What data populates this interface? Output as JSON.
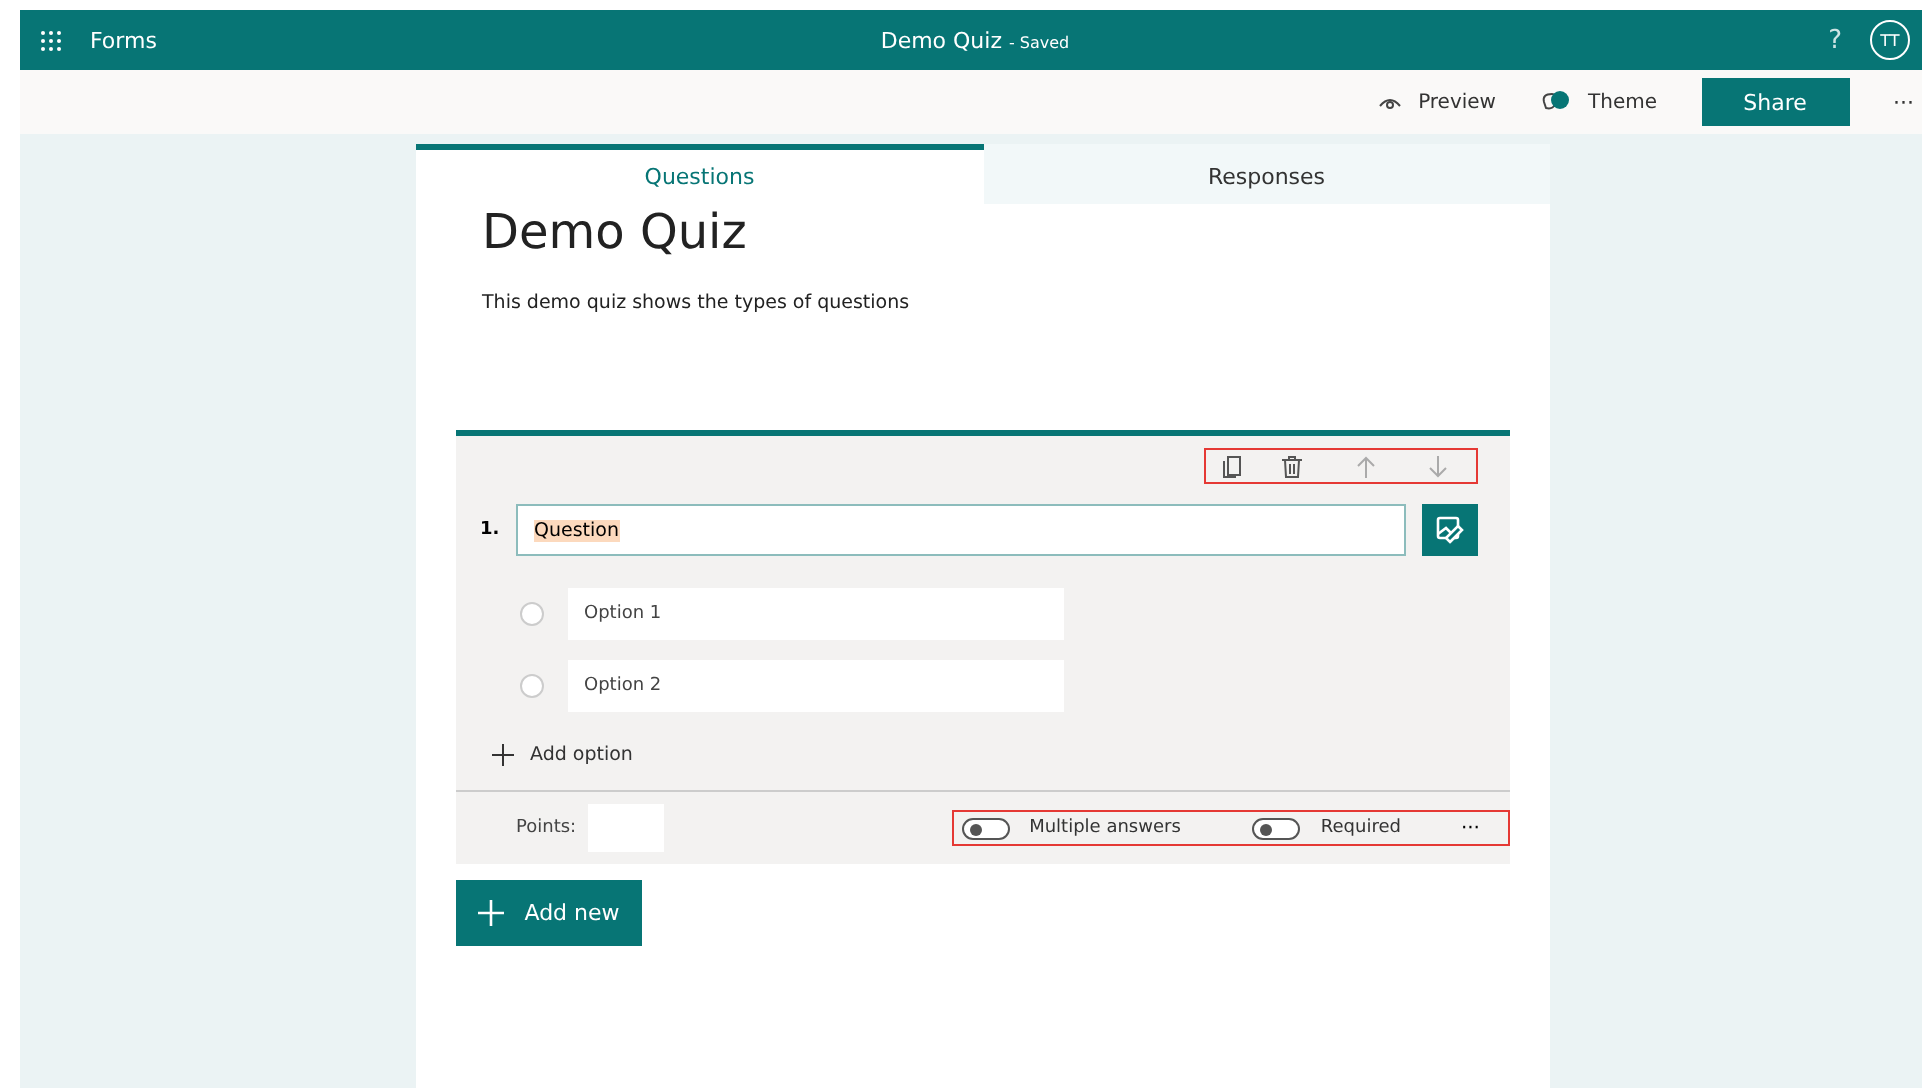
{
  "app": {
    "name": "Forms"
  },
  "document": {
    "title": "Demo Quiz",
    "status": "- Saved"
  },
  "header": {
    "help": "?",
    "avatar": "TT"
  },
  "commands": [
    {
      "label": "Preview",
      "kind": "preview"
    },
    {
      "label": "Theme",
      "kind": "theme"
    },
    {
      "label": "Share",
      "kind": "primary"
    },
    {
      "label": "···",
      "kind": "more"
    }
  ],
  "tabs": [
    {
      "label": "Questions",
      "selected": true
    },
    {
      "label": "Responses",
      "selected": false
    }
  ],
  "form": {
    "title": "Demo Quiz",
    "description": "This demo quiz shows the types of questions"
  },
  "question": {
    "number": "1.",
    "text": "Question",
    "text_selected": true,
    "options": [
      {
        "label": "Option 1",
        "selected": false
      },
      {
        "label": "Option 2",
        "selected": false
      }
    ],
    "add_option": "Add option",
    "points_label": "Points:",
    "toggles": [
      {
        "label": "Multiple answers",
        "on": false
      },
      {
        "label": "Required",
        "on": false
      }
    ],
    "more": "···"
  },
  "add_new": "Add new"
}
